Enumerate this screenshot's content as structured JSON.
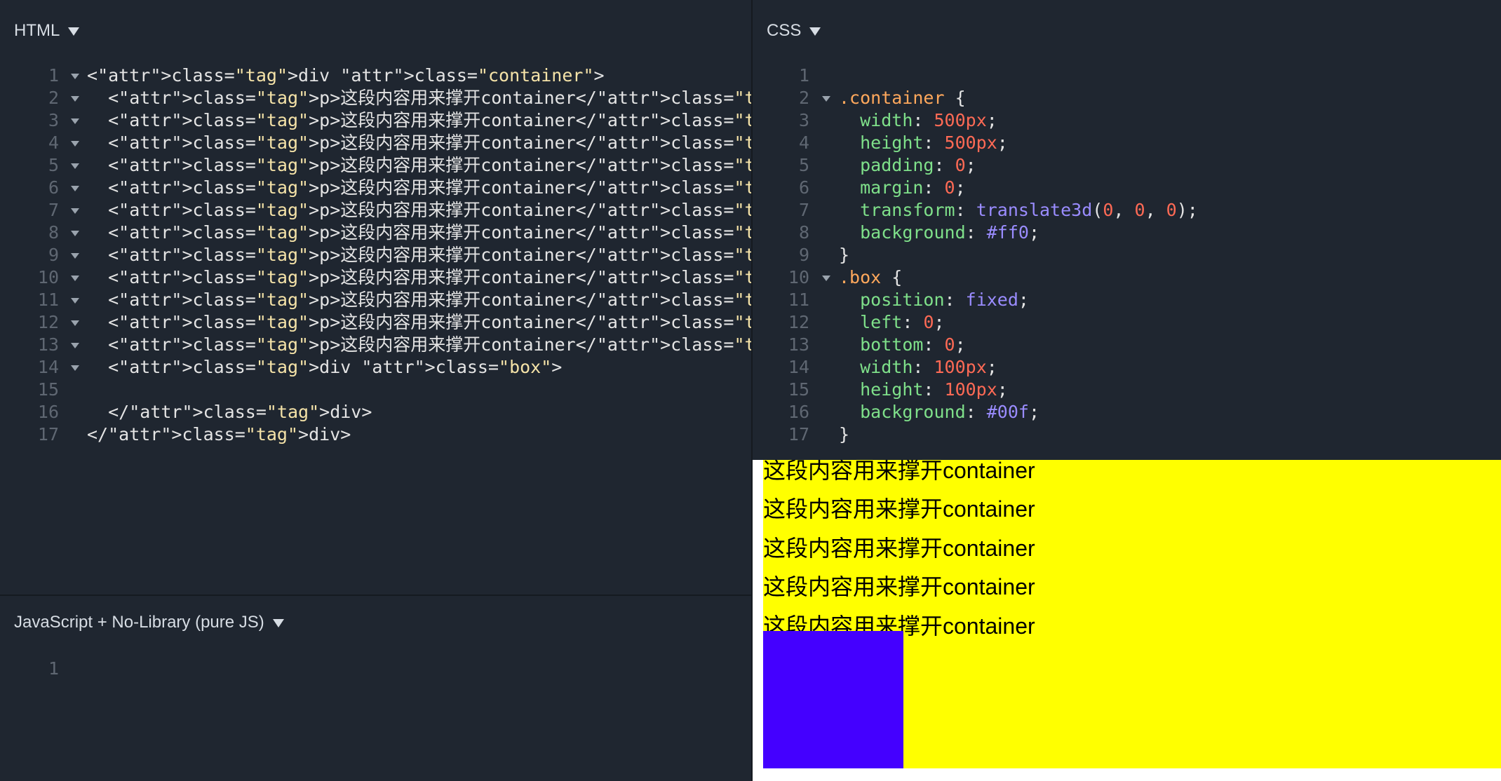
{
  "panels": {
    "html": {
      "title": "HTML"
    },
    "css": {
      "title": "CSS"
    },
    "js": {
      "title": "JavaScript + No-Library (pure JS)"
    }
  },
  "html_lines": [
    "<div class=\"container\">",
    "  <p>这段内容用来撑开container</p>",
    "  <p>这段内容用来撑开container</p>",
    "  <p>这段内容用来撑开container</p>",
    "  <p>这段内容用来撑开container</p>",
    "  <p>这段内容用来撑开container</p>",
    "  <p>这段内容用来撑开container</p>",
    "  <p>这段内容用来撑开container</p>",
    "  <p>这段内容用来撑开container</p>",
    "  <p>这段内容用来撑开container</p>",
    "  <p>这段内容用来撑开container</p>",
    "  <p>这段内容用来撑开container</p>",
    "  <p>这段内容用来撑开container</p>",
    "  <div class=\"box\">",
    "",
    "  </div>",
    "</div>"
  ],
  "css_lines": [
    "",
    ".container {",
    "  width: 500px;",
    "  height: 500px;",
    "  padding: 0;",
    "  margin: 0;",
    "  transform: translate3d(0, 0, 0);",
    "  background: #ff0;",
    "}",
    ".box {",
    "  position: fixed;",
    "  left: 0;",
    "  bottom: 0;",
    "  width: 100px;",
    "  height: 100px;",
    "  background: #00f;",
    "}"
  ],
  "js_lines": [
    ""
  ],
  "preview": {
    "paragraph_text": "这段内容用来撑开container",
    "visible_paragraphs": 5,
    "container_color": "#ffff00",
    "box_color": "#4400ff"
  }
}
